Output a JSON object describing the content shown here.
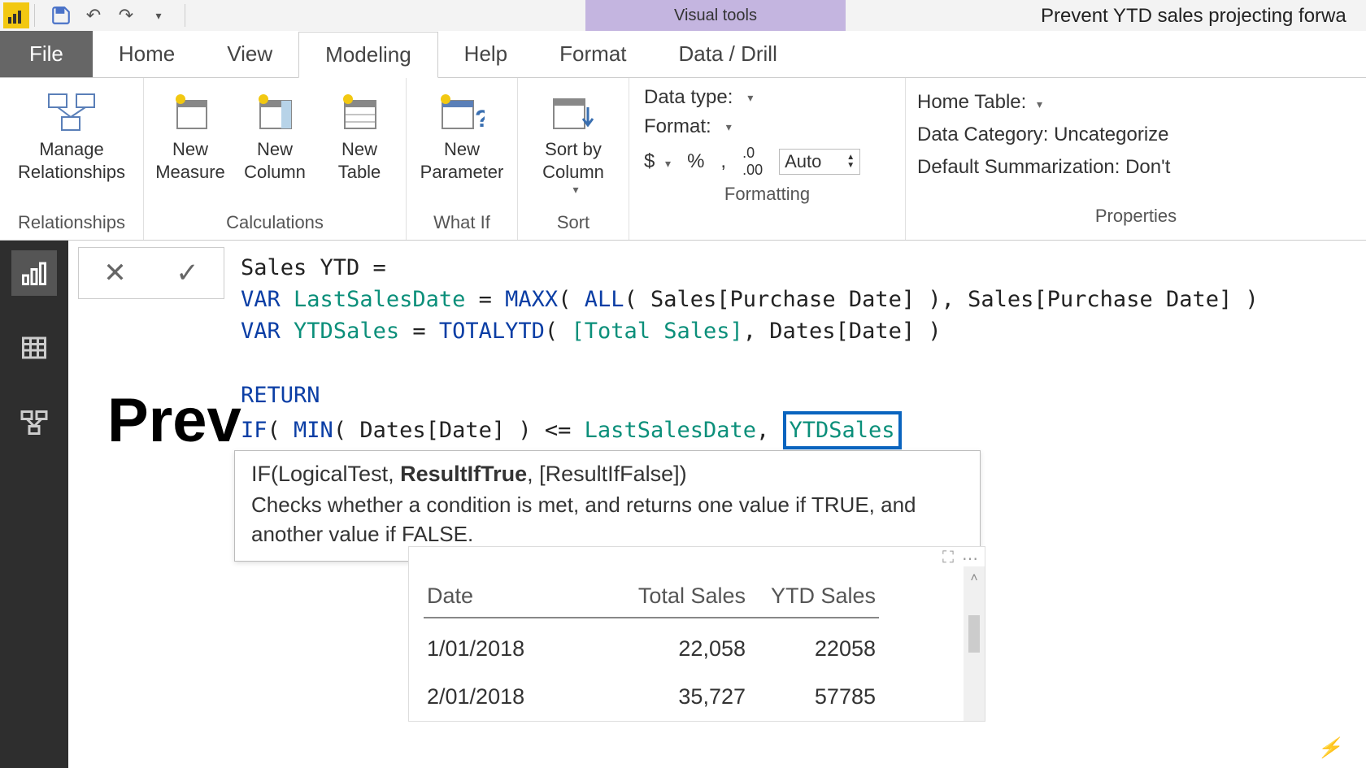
{
  "titlebar": {
    "context_tools": "Visual tools",
    "doc_title": "Prevent YTD sales projecting forwa"
  },
  "tabs": {
    "file": "File",
    "items": [
      "Home",
      "View",
      "Modeling",
      "Help",
      "Format",
      "Data / Drill"
    ],
    "active_index": 2
  },
  "ribbon": {
    "relationships": {
      "manage": "Manage\nRelationships",
      "group": "Relationships"
    },
    "calculations": {
      "measure": "New\nMeasure",
      "column": "New\nColumn",
      "table": "New\nTable",
      "group": "Calculations"
    },
    "whatif": {
      "param": "New\nParameter",
      "group": "What If"
    },
    "sort": {
      "btn": "Sort by\nColumn",
      "group": "Sort"
    },
    "formatting": {
      "datatype_lbl": "Data type:",
      "format_lbl": "Format:",
      "auto": "Auto",
      "group": "Formatting",
      "currency": "$",
      "percent": "%",
      "comma": ",",
      "decimals": ".00"
    },
    "properties": {
      "home_table": "Home Table:",
      "data_category": "Data Category: Uncategorize",
      "default_summ": "Default Summarization: Don't",
      "group": "Properties"
    }
  },
  "dax": {
    "l1_a": "Sales YTD =",
    "l2_kw": "VAR",
    "l2_var": "LastSalesDate",
    "l2_eq": " = ",
    "l2_fn1": "MAXX",
    "l2_p1": "( ",
    "l2_fn2": "ALL",
    "l2_p2": "( Sales[Purchase Date] ), Sales[Purchase Date] )",
    "l3_kw": "VAR",
    "l3_var": "YTDSales",
    "l3_eq": " = ",
    "l3_fn": "TOTALYTD",
    "l3_p1": "( ",
    "l3_col": "[Total Sales]",
    "l3_p2": ", Dates[Date] )",
    "l5_kw": "RETURN",
    "l6_fn": "IF",
    "l6_p1": "( ",
    "l6_fn2": "MIN",
    "l6_p2": "( Dates[Date] ) <= ",
    "l6_var1": "LastSalesDate",
    "l6_comma": ", ",
    "l6_var2": "YTDSales"
  },
  "tooltip": {
    "sig_pre": "IF(LogicalTest, ",
    "sig_bold": "ResultIfTrue",
    "sig_post": ", [ResultIfFalse])",
    "desc": "Checks whether a condition is met, and returns one value if TRUE, and another value if FALSE."
  },
  "big_title": "Prev",
  "table": {
    "columns": [
      "Date",
      "Total Sales",
      "YTD Sales"
    ],
    "rows": [
      {
        "date": "1/01/2018",
        "total": "22,058",
        "ytd": "22058"
      },
      {
        "date": "2/01/2018",
        "total": "35,727",
        "ytd": "57785"
      }
    ]
  },
  "watermark": "⚡"
}
